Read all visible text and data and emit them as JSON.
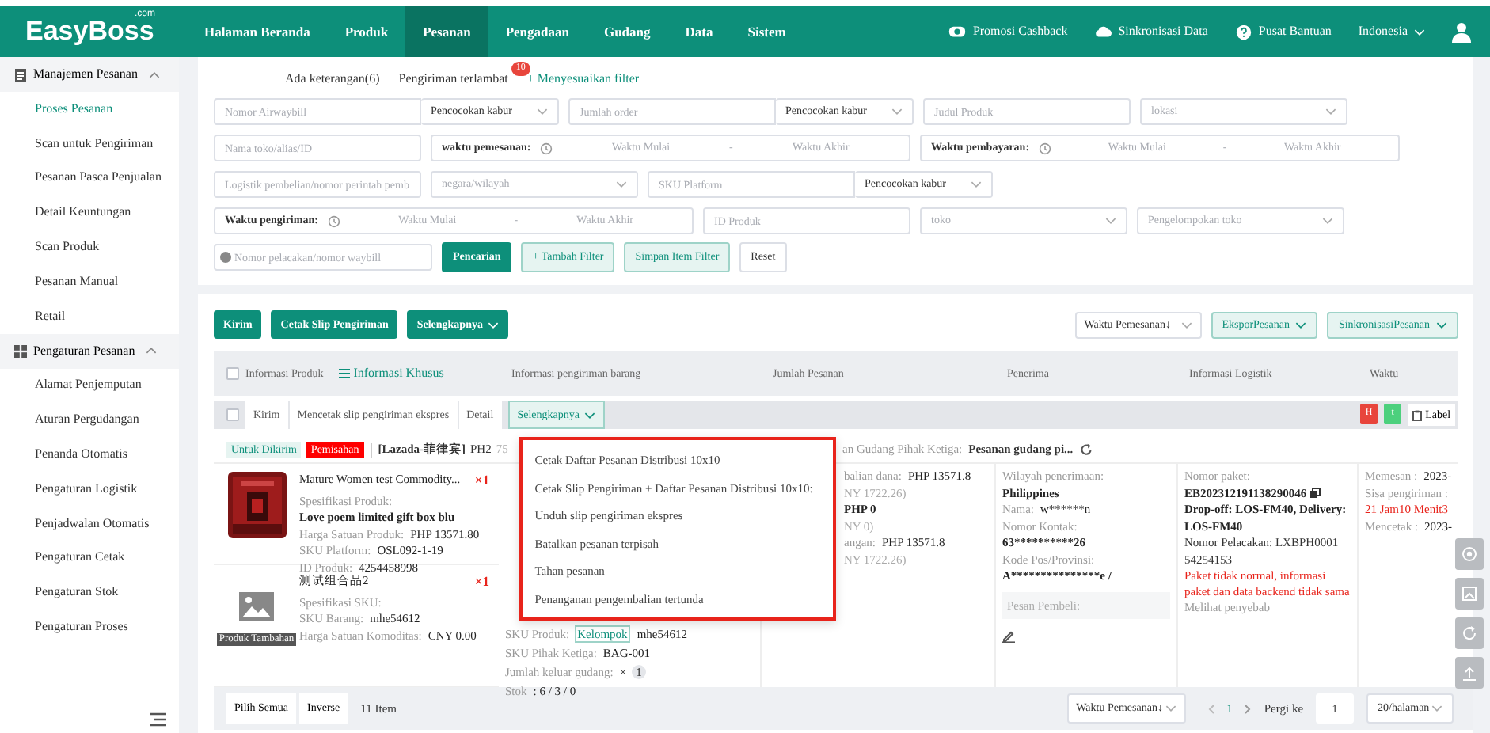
{
  "topnav": {
    "logo": "EasyBoss",
    "logo_suffix": ".com",
    "items": [
      {
        "label": "Halaman Beranda",
        "selected": false
      },
      {
        "label": "Produk",
        "selected": false
      },
      {
        "label": "Pesanan",
        "selected": true
      },
      {
        "label": "Pengadaan",
        "selected": false
      },
      {
        "label": "Gudang",
        "selected": false
      },
      {
        "label": "Data",
        "selected": false
      },
      {
        "label": "Sistem",
        "selected": false
      }
    ],
    "links": [
      {
        "label": "Promosi Cashback",
        "kind": "cashback"
      },
      {
        "label": "Sinkronisasi Data",
        "kind": "sync"
      },
      {
        "label": "Pusat Bantuan",
        "kind": "help"
      }
    ],
    "language": "Indonesia"
  },
  "sidebar": {
    "groups": [
      {
        "title": "Manajemen Pesanan",
        "kind": "orders",
        "expanded": true,
        "items": [
          {
            "label": "Proses Pesanan",
            "selected": true
          },
          {
            "label": "Scan untuk Pengiriman",
            "selected": false
          },
          {
            "label": "Pesanan Pasca Penjualan",
            "selected": false
          },
          {
            "label": "Detail Keuntungan",
            "selected": false
          },
          {
            "label": "Scan Produk",
            "selected": false
          },
          {
            "label": "Pesanan Manual",
            "selected": false
          },
          {
            "label": "Retail",
            "selected": false
          }
        ]
      },
      {
        "title": "Pengaturan Pesanan",
        "kind": "settings",
        "expanded": true,
        "items": [
          {
            "label": "Alamat Penjemputan",
            "selected": false
          },
          {
            "label": "Aturan Pergudangan",
            "selected": false
          },
          {
            "label": "Penanda Otomatis",
            "selected": false
          },
          {
            "label": "Pengaturan Logistik",
            "selected": false
          },
          {
            "label": "Penjadwalan Otomatis",
            "selected": false
          },
          {
            "label": "Pengaturan Cetak",
            "selected": false
          },
          {
            "label": "Pengaturan Stok",
            "selected": false
          },
          {
            "label": "Pengaturan Proses",
            "selected": false
          }
        ]
      }
    ]
  },
  "quick_filters": [
    {
      "label": "Ada keterangan(6)",
      "kind": "text"
    },
    {
      "label": "Pengiriman terlambat",
      "kind": "text",
      "badge": "10"
    },
    {
      "label": "+ Menyesuaikan filter",
      "kind": "link"
    }
  ],
  "filter_rows": [
    [
      {
        "kind": "combo",
        "placeholder": "Nomor Airwaybill",
        "value": "Pencocokan kabur"
      },
      {
        "kind": "combo",
        "placeholder": "Jumlah order",
        "value": "Pencocokan kabur"
      },
      {
        "kind": "input",
        "placeholder": "Judul Produk"
      },
      {
        "kind": "select",
        "placeholder": "lokasi"
      }
    ],
    [
      {
        "kind": "input",
        "placeholder": "Nama toko/alias/ID"
      },
      {
        "kind": "range",
        "label": "waktu pemesanan:",
        "start": "Waktu Mulai",
        "separator": "-",
        "end": "Waktu Akhir"
      },
      {
        "kind": "range",
        "label": "Waktu pembayaran:",
        "start": "Waktu Mulai",
        "separator": "-",
        "end": "Waktu Akhir"
      }
    ],
    [
      {
        "kind": "input",
        "placeholder": "Logistik pembelian/nomor perintah pemb"
      },
      {
        "kind": "select",
        "placeholder": "negara/wilayah"
      },
      {
        "kind": "combo",
        "placeholder": "SKU Platform",
        "value": "Pencocokan kabur"
      }
    ],
    [
      {
        "kind": "range",
        "label": "Waktu pengiriman:",
        "start": "Waktu Mulai",
        "separator": "-",
        "end": "Waktu Akhir"
      },
      {
        "kind": "input",
        "placeholder": "ID Produk"
      },
      {
        "kind": "select",
        "placeholder": "toko"
      },
      {
        "kind": "select",
        "placeholder": "Pengelompokan toko"
      }
    ],
    [
      {
        "kind": "search",
        "placeholder": "Nomor pelacakan/nomor waybill"
      }
    ]
  ],
  "filter_buttons": [
    {
      "label": "Pencarian",
      "kind": "primary"
    },
    {
      "label": "+ Tambah Filter",
      "kind": "soft"
    },
    {
      "label": "Simpan Item Filter",
      "kind": "soft"
    },
    {
      "label": "Reset",
      "kind": "plain"
    }
  ],
  "toolbar": {
    "actions": [
      {
        "label": "Kirim",
        "dropdown": false
      },
      {
        "label": "Cetak Slip Pengiriman",
        "dropdown": false
      },
      {
        "label": "Selengkapnya",
        "dropdown": true
      }
    ],
    "sort": "Waktu Pemesanan↓",
    "menus": [
      "EksporPesanan",
      "SinkronisasiPesanan"
    ]
  },
  "table": {
    "all_checked": false,
    "columns": [
      {
        "label": "Informasi Produk",
        "link": "Informasi Khusus"
      },
      {
        "label": "Informasi pengiriman barang"
      },
      {
        "label": "Jumlah Pesanan"
      },
      {
        "label": "Penerima"
      },
      {
        "label": "Informasi Logistik"
      },
      {
        "label": "Waktu"
      }
    ],
    "batch_checked": false,
    "batch_actions": [
      {
        "label": "Kirim",
        "dropdown": false,
        "expanded": false
      },
      {
        "label": "Mencetak slip pengiriman ekspres",
        "dropdown": false,
        "expanded": false
      },
      {
        "label": "Detail",
        "dropdown": false,
        "expanded": false
      },
      {
        "label": "Selengkapnya",
        "dropdown": true,
        "expanded": true
      }
    ],
    "batch_flags": [
      {
        "label": "H",
        "color": "#e8453c"
      },
      {
        "label": "t",
        "color": "#4cd07d"
      }
    ],
    "label_button": "Label",
    "menu": [
      "Cetak Daftar Pesanan Distribusi 10x10",
      "Cetak Slip Pengiriman + Daftar Pesanan Distribusi 10x10:",
      "Unduh slip pengiriman ekspres",
      "Batalkan pesanan terpisah",
      "Tahan pesanan",
      "Penanganan pengembalian tertunda"
    ],
    "order": {
      "status": "Untuk Dikirim",
      "tag": "Pemisahan",
      "store": "[Lazada-菲律宾]",
      "code": "PH2",
      "number": "75",
      "warehouse_label": "an Gudang Pihak Ketiga:",
      "warehouse": "Pesanan gudang pi...",
      "items": [
        {
          "kind": "product",
          "title": "Mature Women test Commodity...",
          "qty": "×1",
          "specs": [
            {
              "label": "Spesifikasi Produk:"
            },
            {
              "value": "Love poem limited gift box blu"
            },
            {
              "label": "Harga Satuan Produk:",
              "value": "PHP 13571.80"
            },
            {
              "label": "SKU Platform:",
              "value": "OSL092-1-19"
            },
            {
              "label": "ID Produk:",
              "value": "4254458998"
            }
          ]
        },
        {
          "kind": "addon",
          "badge": "Produk Tambahan",
          "title": "测试组合品2",
          "qty": "×1",
          "specs": [
            {
              "label": "Spesifikasi SKU:"
            },
            {
              "label": "SKU Barang:",
              "value": "mhe54612"
            },
            {
              "label": "Harga Satuan Komoditas:",
              "value": "CNY 0.00"
            }
          ],
          "shipping": [
            {
              "label": "SKU Produk:",
              "tag": "Kelompok",
              "value": "mhe54612"
            },
            {
              "label": "SKU Pihak Ketiga:",
              "value": "BAG-001"
            },
            {
              "label": "Jumlah keluar gudang:",
              "value": "×",
              "count": "1"
            },
            {
              "label": "Stok",
              "value": ": 6 / 3 / 0"
            }
          ]
        }
      ],
      "amount": [
        {
          "label": "balian dana:",
          "value": "PHP 13571.8"
        },
        {
          "note": "NY 1722.26)"
        },
        {
          "value": "PHP 0"
        },
        {
          "note": "NY 0)"
        },
        {
          "label": "angan:",
          "value": "PHP 13571.8"
        },
        {
          "note": "NY 1722.26)"
        }
      ],
      "recipient": [
        {
          "label": "Wilayah penerimaan:"
        },
        {
          "value": "Philippines"
        },
        {
          "label": "Nama:",
          "value": "w******n"
        },
        {
          "label": "Nomor Kontak:"
        },
        {
          "value": "63**********26"
        },
        {
          "label": "Kode Pos/Provinsi:"
        },
        {
          "value": "A***************e /"
        }
      ],
      "buyer_message": "Pesan Pembeli:",
      "logistics": [
        {
          "label": "Nomor paket:"
        },
        {
          "value": "EB202312191138290046",
          "copy": true
        },
        {
          "value": "Drop-off: LOS-FM40, Delivery: LOS-FM40"
        },
        {
          "label": "Nomor Pelacakan:",
          "value": "LXBPH0001 54254153"
        }
      ],
      "warning": "Paket tidak normal, informasi paket dan data backend tidak sama",
      "reason_link": "Melihat penyebab",
      "times": [
        {
          "label": "Memesan :",
          "value": "2023-"
        },
        {
          "label": "Sisa pengiriman :"
        },
        {
          "alert": "21 Jam10 Menit3"
        },
        {
          "label": "Mencetak :",
          "value": "2023-"
        }
      ]
    }
  },
  "footer": {
    "select_all": "Pilih Semua",
    "inverse": "Inverse",
    "count": "11 Item",
    "sort": "Waktu Pemesanan↓",
    "page": "1",
    "goto_label": "Pergi ke",
    "goto_value": "1",
    "page_size": "20/halaman"
  }
}
